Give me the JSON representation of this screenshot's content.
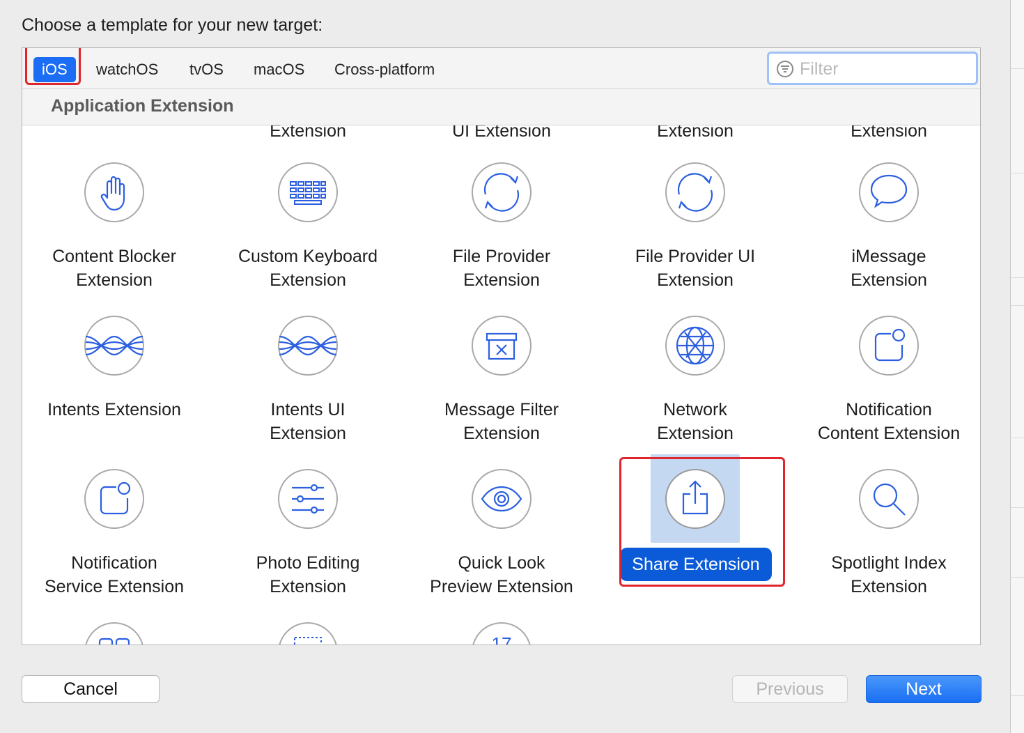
{
  "dialog": {
    "heading": "Choose a template for your new target:"
  },
  "platform_tabs": [
    {
      "label": "iOS",
      "selected": true
    },
    {
      "label": "watchOS"
    },
    {
      "label": "tvOS"
    },
    {
      "label": "macOS"
    },
    {
      "label": "Cross-platform"
    }
  ],
  "filter": {
    "placeholder": "Filter",
    "value": ""
  },
  "section": {
    "title": "Application Extension"
  },
  "partial_top_labels": [
    "Extension",
    "UI Extension",
    "Extension",
    "Extension"
  ],
  "templates": [
    {
      "line1": "Content Blocker",
      "line2": "Extension",
      "icon": "hand-icon"
    },
    {
      "line1": "Custom Keyboard",
      "line2": "Extension",
      "icon": "keyboard-icon"
    },
    {
      "line1": "File Provider",
      "line2": "Extension",
      "icon": "sync-arrows-icon"
    },
    {
      "line1": "File Provider UI",
      "line2": "Extension",
      "icon": "sync-arrows-icon"
    },
    {
      "line1": "iMessage",
      "line2": "Extension",
      "icon": "speech-bubble-icon"
    },
    {
      "line1": "Intents Extension",
      "line2": "",
      "icon": "intents-waves-icon"
    },
    {
      "line1": "Intents UI",
      "line2": "Extension",
      "icon": "intents-waves-icon"
    },
    {
      "line1": "Message Filter",
      "line2": "Extension",
      "icon": "filter-bin-icon"
    },
    {
      "line1": "Network",
      "line2": "Extension",
      "icon": "globe-icon"
    },
    {
      "line1": "Notification",
      "line2": "Content Extension",
      "icon": "notification-icon"
    },
    {
      "line1": "Notification",
      "line2": "Service Extension",
      "icon": "notification-icon"
    },
    {
      "line1": "Photo Editing",
      "line2": "Extension",
      "icon": "sliders-icon"
    },
    {
      "line1": "Quick Look",
      "line2": "Preview Extension",
      "icon": "eye-icon"
    },
    {
      "line1": "Share Extension",
      "line2": "",
      "icon": "share-icon",
      "selected": true
    },
    {
      "line1": "Spotlight Index",
      "line2": "Extension",
      "icon": "magnifier-icon"
    }
  ],
  "partial_bottom_icons": [
    "grid-icon",
    "dotted-frame-icon",
    "calendar-icon"
  ],
  "partial_bottom_calendar_text": "17",
  "buttons": {
    "cancel": "Cancel",
    "previous": "Previous",
    "next": "Next"
  },
  "colors": {
    "accent": "#1b6ef3",
    "selection": "#0b5bd8",
    "highlight_box": "#e0262d",
    "icon_blue": "#2c5fe0"
  }
}
